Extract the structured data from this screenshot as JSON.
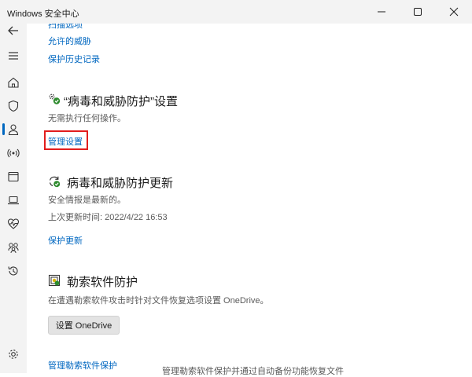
{
  "window": {
    "title": "Windows 安全中心"
  },
  "sidebar": {
    "items": [
      {
        "icon": "back-arrow-icon"
      },
      {
        "icon": "menu-icon"
      },
      {
        "icon": "home-icon"
      },
      {
        "icon": "shield-icon",
        "selected": true
      },
      {
        "icon": "person-icon"
      },
      {
        "icon": "wifi-antenna-icon"
      },
      {
        "icon": "app-browser-icon"
      },
      {
        "icon": "laptop-icon"
      },
      {
        "icon": "heart-pulse-icon"
      },
      {
        "icon": "family-icon"
      },
      {
        "icon": "history-icon"
      },
      {
        "icon": "settings-gear-icon"
      }
    ]
  },
  "top_links": {
    "scan_options": "扫描选项",
    "allowed_threats": "允许的威胁",
    "protection_history": "保护历史记录"
  },
  "virus_settings": {
    "title": "“病毒和威胁防护”设置",
    "status": "无需执行任何操作。",
    "manage_link": "管理设置"
  },
  "virus_updates": {
    "title": "病毒和威胁防护更新",
    "status": "安全情报是最新的。",
    "last_update": "上次更新时间: 2022/4/22 16:53",
    "link": "保护更新"
  },
  "ransomware": {
    "title": "勒索软件防护",
    "description": "在遭遇勒索软件攻击时针对文件恢复选项设置 OneDrive。",
    "button": "设置 OneDrive",
    "link": "管理勒索软件保护",
    "clipped_text": "管理勒索软件保护并通过自动备份功能恢复文件"
  },
  "colors": {
    "accent": "#0067c0",
    "highlight_border": "#e21d1d"
  }
}
